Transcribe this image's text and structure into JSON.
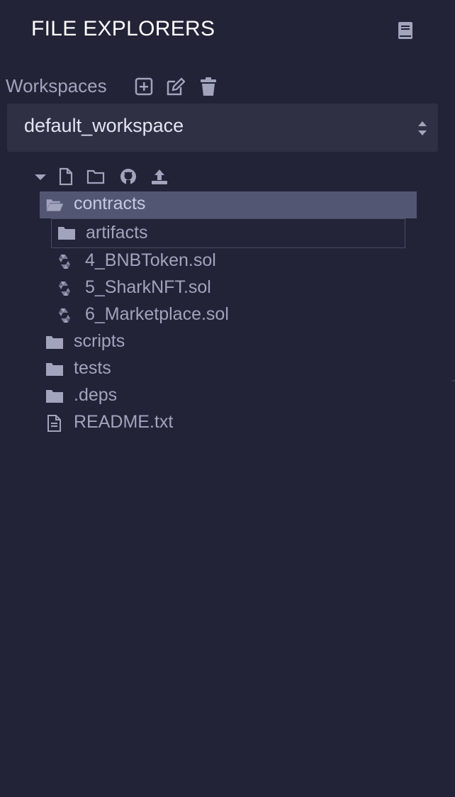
{
  "header": {
    "title": "FILE EXPLORERS",
    "docs_icon": "book-icon"
  },
  "workspaces": {
    "label": "Workspaces",
    "create_icon": "plus-square-icon",
    "rename_icon": "edit-icon",
    "delete_icon": "trash-icon",
    "selected": "default_workspace"
  },
  "toolbar": {
    "icons": [
      "caret-down-icon",
      "new-file-icon",
      "new-folder-icon",
      "github-icon",
      "upload-icon"
    ]
  },
  "tree": {
    "contracts": "contracts",
    "artifacts": "artifacts",
    "files": [
      "4_BNBToken.sol",
      "5_SharkNFT.sol",
      "6_Marketplace.sol"
    ],
    "scripts": "scripts",
    "tests": "tests",
    "deps": ".deps",
    "readme": "README.txt"
  },
  "colors": {
    "background": "#222336",
    "selected_row": "#535673",
    "select_bg": "#2f3044",
    "text": "#a2a3bd",
    "title": "#ffffff"
  }
}
